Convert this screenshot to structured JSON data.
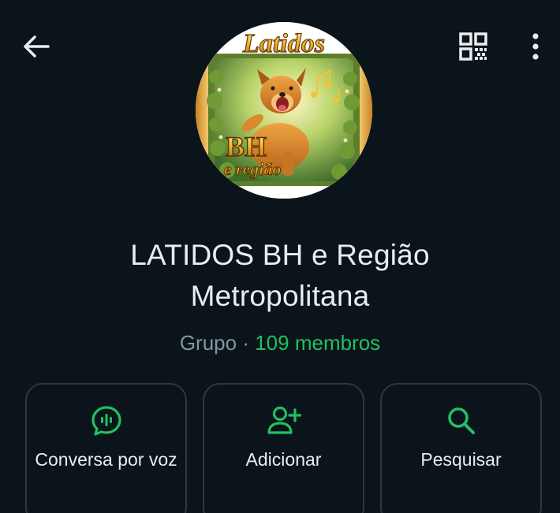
{
  "header": {
    "back_icon": "arrow-left-icon",
    "qr_icon": "qr-code-icon",
    "menu_icon": "more-vert-icon"
  },
  "avatar": {
    "logo_text_top": "Latidos",
    "logo_text_main": "BH",
    "logo_text_sub": "e região"
  },
  "group": {
    "name_line1": "LATIDOS BH e Região",
    "name_line2": "Metropolitana",
    "type": "Grupo",
    "separator": "·",
    "members": "109 membros"
  },
  "actions": {
    "voice": {
      "label": "Conversa por voz",
      "icon": "voice-chat-icon"
    },
    "add": {
      "label": "Adicionar",
      "icon": "add-person-icon"
    },
    "search": {
      "label": "Pesquisar",
      "icon": "search-icon"
    }
  },
  "colors": {
    "background": "#0b141a",
    "accent": "#21c063",
    "text_primary": "#e9edef",
    "text_secondary": "#8696a0",
    "card_border": "#2a3942"
  }
}
